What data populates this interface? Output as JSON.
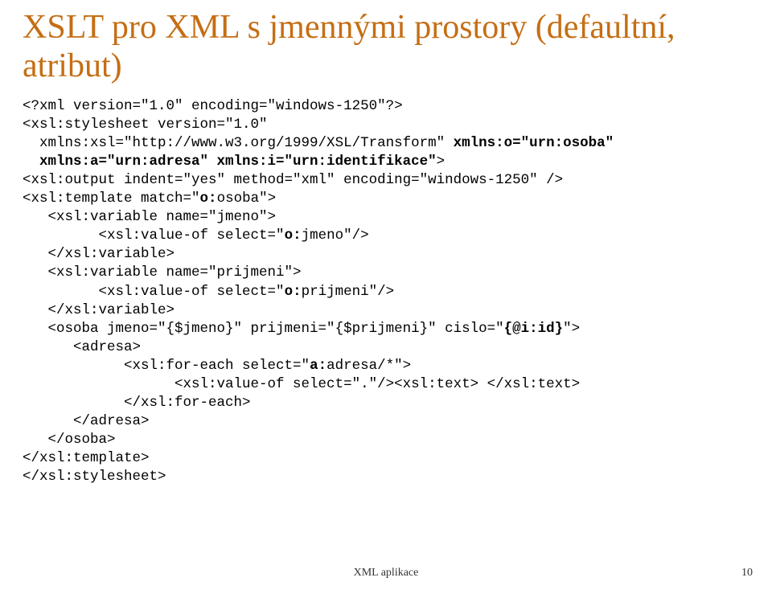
{
  "title": "XSLT pro XML s jmennými prostory (defaultní, atribut)",
  "code": {
    "l1": "<?xml version=\"1.0\" encoding=\"windows-1250\"?>",
    "l2a": "<xsl:stylesheet version=\"1.0\"",
    "l2b": "  xmlns:xsl=\"http://www.w3.org/1999/XSL/Transform\" ",
    "l2c": "xmlns:o=\"urn:osoba\"",
    "l2d": "  xmlns:a=\"urn:adresa\" xmlns:i=\"urn:identifikace\"",
    "l2e": ">",
    "l3": "<xsl:output indent=\"yes\" method=\"xml\" encoding=\"windows-1250\" />",
    "l4a": "<xsl:template match=\"",
    "l4b": "o:",
    "l4c": "osoba\">",
    "l5": "   <xsl:variable name=\"jmeno\">",
    "l6a": "         <xsl:value-of select=\"",
    "l6b": "o:",
    "l6c": "jmeno\"/>",
    "l7": "   </xsl:variable>",
    "l8": "   <xsl:variable name=\"prijmeni\">",
    "l9a": "         <xsl:value-of select=\"",
    "l9b": "o:",
    "l9c": "prijmeni\"/>",
    "l10": "   </xsl:variable>",
    "l11a": "   <osoba jmeno=\"{$jmeno}\" prijmeni=\"{$prijmeni}\" cislo=\"",
    "l11b": "{@i:id}",
    "l11c": "\">",
    "l12": "      <adresa>",
    "l13a": "            <xsl:for-each select=\"",
    "l13b": "a:",
    "l13c": "adresa/*\">",
    "l14": "                  <xsl:value-of select=\".\"/><xsl:text> </xsl:text>",
    "l15": "            </xsl:for-each>",
    "l16": "      </adresa>",
    "l17": "   </osoba>",
    "l18": "</xsl:template>",
    "l19": "</xsl:stylesheet>"
  },
  "footer": {
    "center": "XML aplikace",
    "page": "10"
  }
}
